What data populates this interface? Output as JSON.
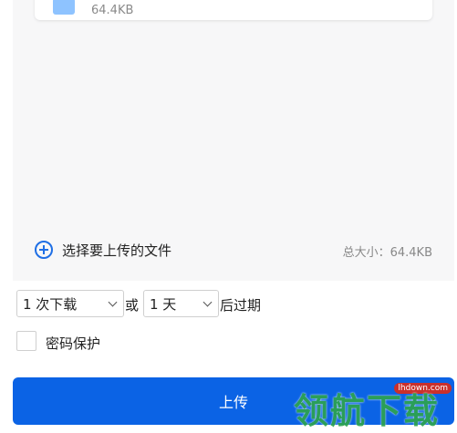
{
  "file": {
    "size": "64.4KB",
    "icon": "folder-icon"
  },
  "add_files": {
    "label": "选择要上传的文件",
    "icon": "add-circle-icon"
  },
  "total_size": "总大小：64.4KB",
  "expiry": {
    "download_count": "1 次下载",
    "or": "或",
    "days": "1 天",
    "after": "后过期"
  },
  "password": {
    "label": "密码保护",
    "checked": false
  },
  "upload_button": {
    "label": "上传"
  },
  "watermark": {
    "site": "lhdown.com",
    "text": "领航下载"
  },
  "colors": {
    "accent": "#0b63e5",
    "icon_blue": "#1f6fe5",
    "panel_bg": "#f7f7f8"
  }
}
